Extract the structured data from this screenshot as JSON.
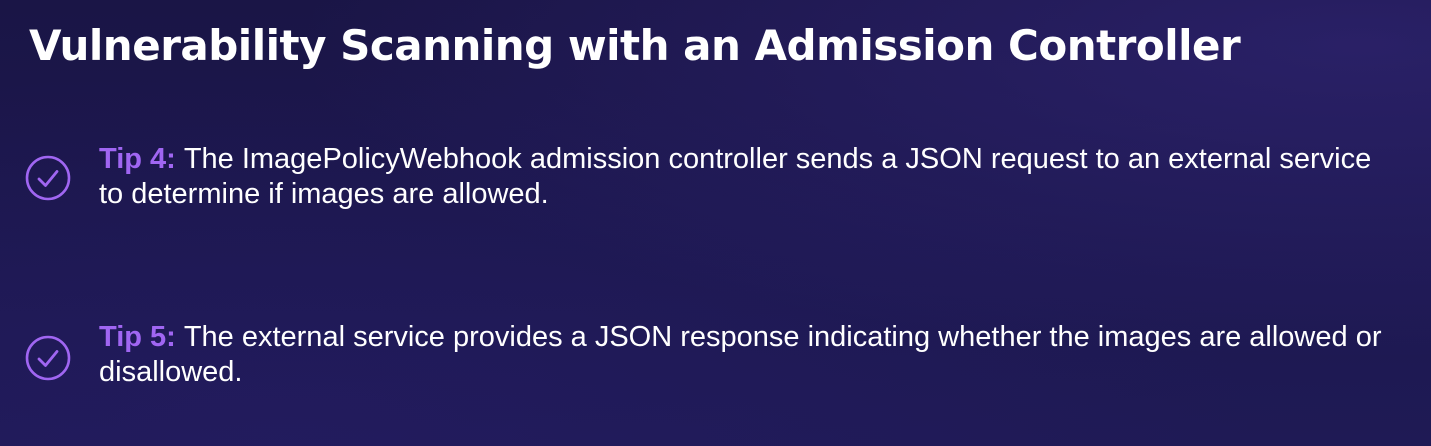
{
  "slide": {
    "title": "Vulnerability Scanning with an Admission Controller",
    "tips": [
      {
        "label": "Tip 4:",
        "text": "The ImagePolicyWebhook admission controller sends a JSON request to an external service to determine if images are allowed.",
        "icon": "check-circle-icon"
      },
      {
        "label": "Tip 5:",
        "text": "The external service provides a JSON response indicating whether the images are allowed or disallowed.",
        "icon": "check-circle-icon"
      }
    ]
  },
  "colors": {
    "background": "#1c1748",
    "title": "#ffffff",
    "accent": "#a066f2",
    "body_text": "#ffffff"
  }
}
